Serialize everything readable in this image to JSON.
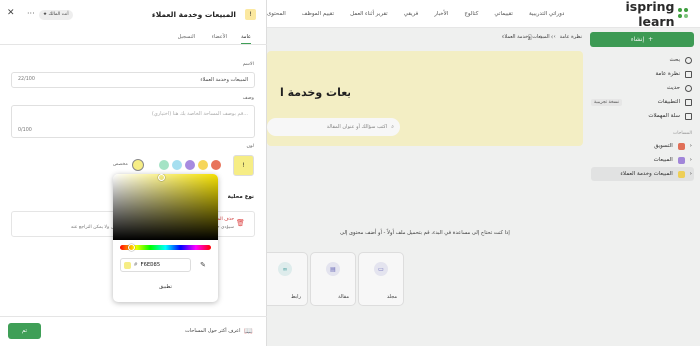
{
  "topnav": {
    "logo": "ispring learn",
    "items": [
      "دوراتي التدريبية",
      "تقييماتي",
      "كتالوج",
      "الأخبار",
      "فريقي",
      "تقرير أثناء العمل",
      "تقييم الموظف",
      "المحتوى"
    ]
  },
  "sidebar": {
    "new_button": "إنشاء",
    "items": [
      {
        "label": "بحث",
        "icon": "search-icon"
      },
      {
        "label": "نظرة عامة",
        "icon": "grid-icon"
      },
      {
        "label": "حديث",
        "icon": "clock-icon"
      },
      {
        "label": "التطبيقات",
        "icon": "apps-icon",
        "badge": "نسخة تجريبية"
      },
      {
        "label": "سلة المهملات",
        "icon": "trash-icon"
      }
    ],
    "section_label": "المساحات",
    "spaces": [
      {
        "label": "التسويق",
        "color": "#e8735a"
      },
      {
        "label": "المبيعات",
        "color": "#a78be0"
      },
      {
        "label": "المبيعات وخدمة العملاء",
        "color": "#f6d65a",
        "active": true
      }
    ]
  },
  "breadcrumb": [
    "نظرة عامة",
    "المبيعات وخدمة العملاء"
  ],
  "main": {
    "banner_title": "المبيعات وخدمة ا",
    "search_placeholder": "اكتب سؤالك أو عنوان المقالة",
    "hint": "إذا كنت تحتاج إلى مساعدة في البدء، قم بتحميل ملف أولاً - أو أضف محتوى إلى",
    "cards": [
      "مجلد",
      "مقالة",
      "رابط"
    ]
  },
  "panel": {
    "title": "المبيعات وخدمة العملاء",
    "chip": "أنت المالك",
    "tabs": [
      "عامة",
      "الأعضاء",
      "التسجيل"
    ],
    "name_label": "الاسم",
    "name_value": "المبيعات وخدمة العملاء",
    "name_count": "22/100",
    "desc_label": "وصف",
    "desc_placeholder": "قم بوصف المساحة الخاصة بك هنا (اختياري)...",
    "desc_count": "0/100",
    "color_label": "لون",
    "selected_color": "#F6ED85",
    "swatches": [
      "#e8735a",
      "#f6d65a",
      "#a78be0",
      "#a6dff0",
      "#a5e3c5"
    ],
    "custom_label": "مخصص",
    "section2": "نوع محلية",
    "warn_line1": "حذف المساحة",
    "warn_line2": "سيؤدي حذف هذه المساحة إلى حذف جميع المحتويات بشكل نهائي ولا يمكن التراجع عنه",
    "done_button": "تم",
    "learn_more": "اعرف أكثر حول المساحات"
  },
  "picker": {
    "hex": "F6ED85",
    "apply": "تطبيق"
  }
}
